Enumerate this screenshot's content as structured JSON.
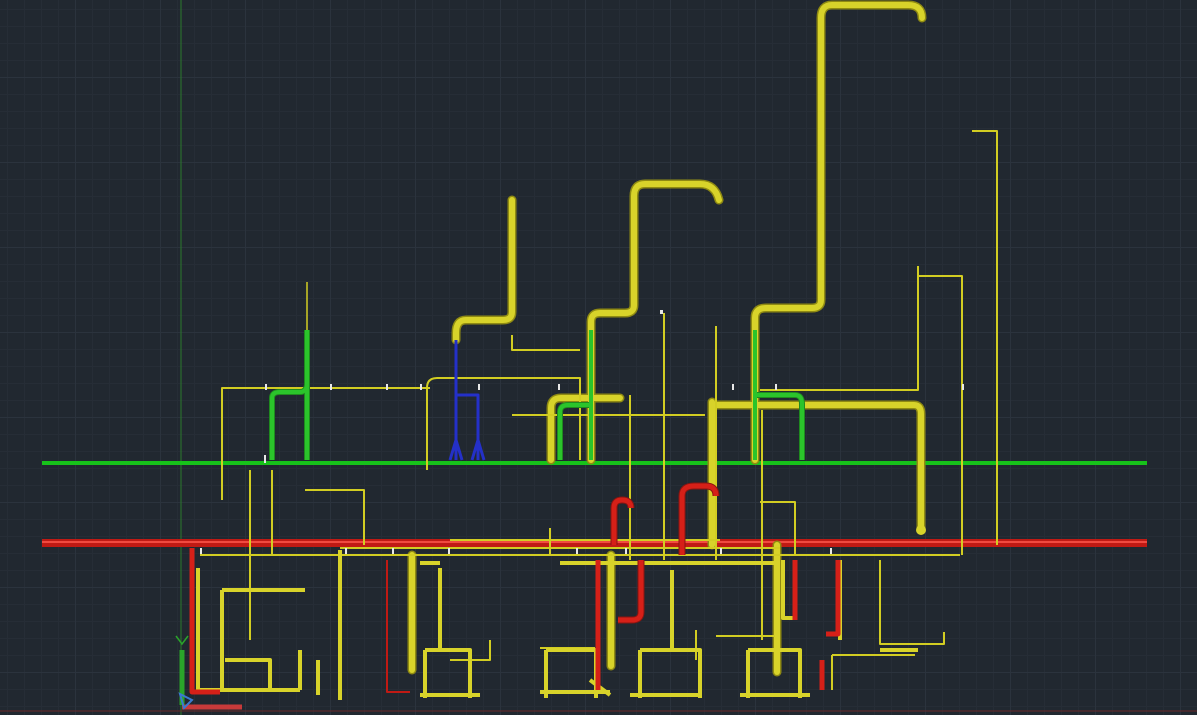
{
  "viewport": {
    "type": "cad-model-space",
    "grid": true
  },
  "colors": {
    "background": "#212830",
    "pipe_yellow": "#d8d32a",
    "pipe_yellow_dark": "#8f8a12",
    "pipe_green": "#2bc42b",
    "pipe_green_line": "#17c21a",
    "pipe_red": "#d62018",
    "pipe_blue": "#2430c8",
    "axis_y": "#2aa52a",
    "axis_x": "#c83a3a",
    "ucs_icon": "#3a7ad0"
  },
  "layers": [
    "yellow-piping",
    "green-piping",
    "red-piping",
    "blue-piping",
    "main-header-green",
    "main-header-red"
  ],
  "icons": {
    "ucs": "ucs-icon"
  }
}
